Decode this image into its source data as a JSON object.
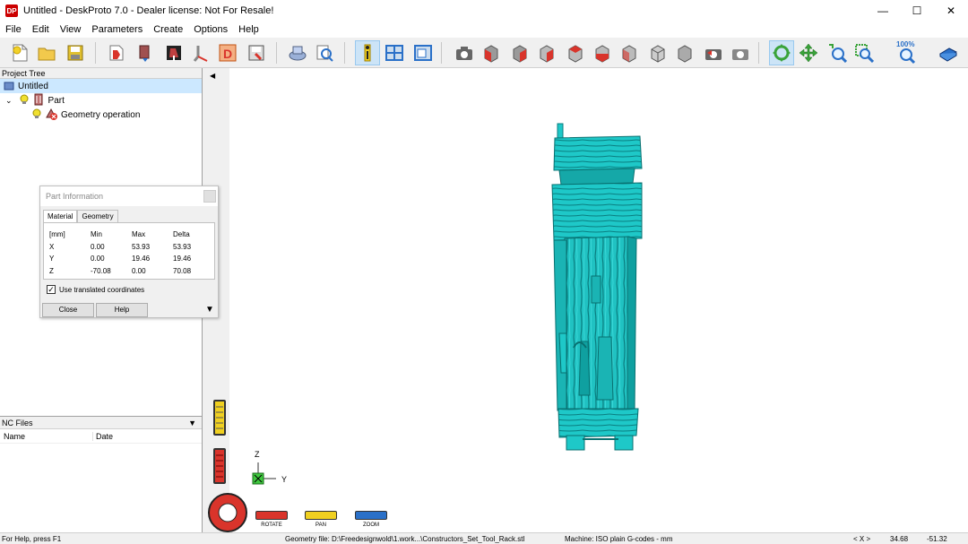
{
  "window": {
    "app_icon_text": "DP",
    "title": "Untitled - DeskProto 7.0 - Dealer license: Not For Resale!",
    "minimize": "—",
    "maximize": "☐",
    "close": "✕"
  },
  "menu": [
    "File",
    "Edit",
    "View",
    "Parameters",
    "Create",
    "Options",
    "Help"
  ],
  "toolbar": {
    "zoom_100_label": "100%",
    "colors": {
      "red": "#d9342b",
      "grey": "#9a9a9a",
      "green": "#3aa33a",
      "blue": "#2a70c8",
      "yellow": "#f0d020"
    }
  },
  "project_tree": {
    "header": "Project Tree",
    "root": "Untitled",
    "part": "Part",
    "operation": "Geometry operation"
  },
  "part_info": {
    "title": "Part Information",
    "tabs": [
      "Material",
      "Geometry"
    ],
    "columns": [
      "[mm]",
      "Min",
      "Max",
      "Delta"
    ],
    "rows": [
      [
        "X",
        "0.00",
        "53.93",
        "53.93"
      ],
      [
        "Y",
        "0.00",
        "19.46",
        "19.46"
      ],
      [
        "Z",
        "-70.08",
        "0.00",
        "70.08"
      ]
    ],
    "checkbox_label": "Use translated coordinates",
    "checkbox_checked": true,
    "close_button": "Close",
    "help_button": "Help"
  },
  "nc_files": {
    "header": "NC Files",
    "columns": [
      "Name",
      "Date"
    ]
  },
  "viewport": {
    "axis_z": "Z",
    "axis_y": "Y",
    "model_color": "#1ec8c8",
    "tools": [
      "ROTATE",
      "PAN",
      "ZOOM"
    ]
  },
  "status": {
    "help": "For Help, press F1",
    "geometry_file": "Geometry file: D:\\Freedesignwold\\1.work...\\Constructors_Set_Tool_Rack.stl",
    "machine": "Machine: ISO plain G-codes - mm",
    "axes": "< X >",
    "x_value": "34.68",
    "y_value": "-51.32"
  }
}
